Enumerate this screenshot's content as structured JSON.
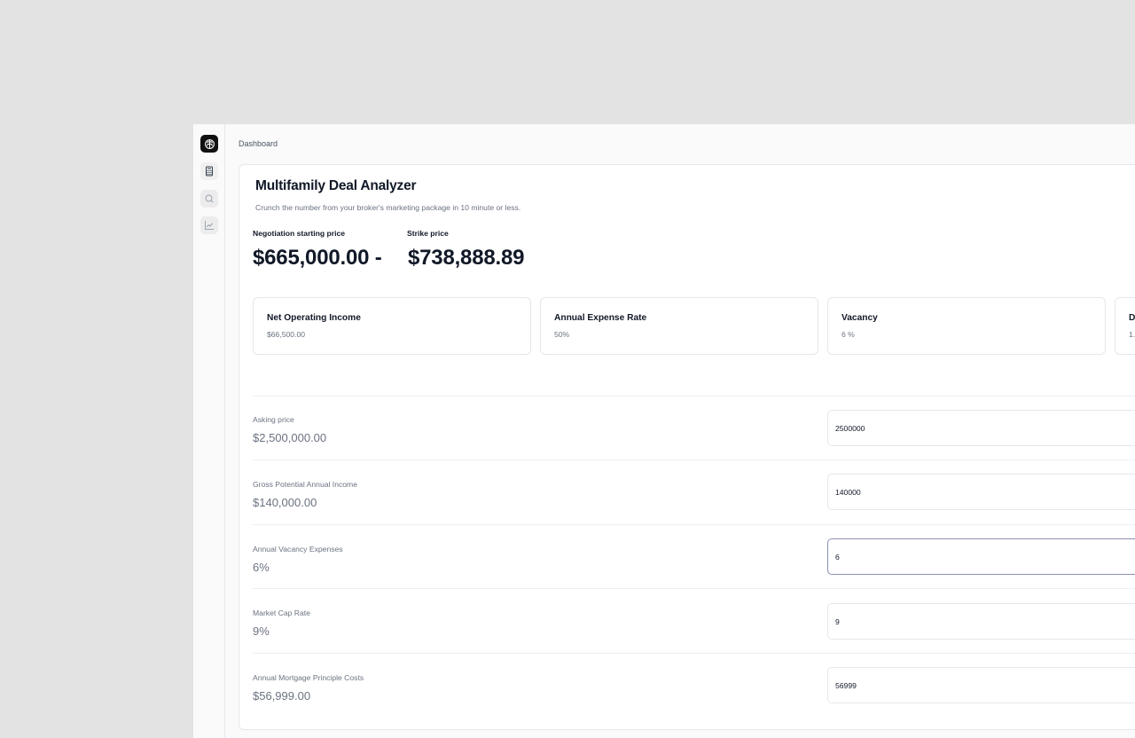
{
  "breadcrumb": "Dashboard",
  "sidebar": {
    "icons": [
      "brain-icon",
      "calculator-icon",
      "search-icon",
      "line-chart-icon"
    ]
  },
  "header": {
    "title": "Multifamily Deal Analyzer",
    "subtitle": "Crunch the number from your broker's marketing package in 10 minute or less."
  },
  "prices": {
    "negotiation_label": "Negotiation starting price",
    "negotiation_value": "$665,000.00 -",
    "strike_label": "Strike price",
    "strike_value": "$738,888.89"
  },
  "stats": [
    {
      "label": "Net Operating Income",
      "value": "$66,500.00"
    },
    {
      "label": "Annual Expense Rate",
      "value": "50%"
    },
    {
      "label": "Vacancy",
      "value": "6 %"
    },
    {
      "label": "D",
      "value": "1."
    }
  ],
  "fields": [
    {
      "label": "Asking price",
      "display": "$2,500,000.00",
      "input": "2500000"
    },
    {
      "label": "Gross Potential Annual Income",
      "display": "$140,000.00",
      "input": "140000"
    },
    {
      "label": "Annual Vacancy Expenses",
      "display": "6%",
      "input": "6"
    },
    {
      "label": "Market Cap Rate",
      "display": "9%",
      "input": "9"
    },
    {
      "label": "Annual Mortgage Principle Costs",
      "display": "$56,999.00",
      "input": "56999"
    }
  ],
  "colors": {
    "background": "#e3e3e3",
    "card": "#ffffff",
    "text": "#111827",
    "muted": "#6b7280",
    "border": "#e5e7eb",
    "focus": "#8b8fb3"
  }
}
